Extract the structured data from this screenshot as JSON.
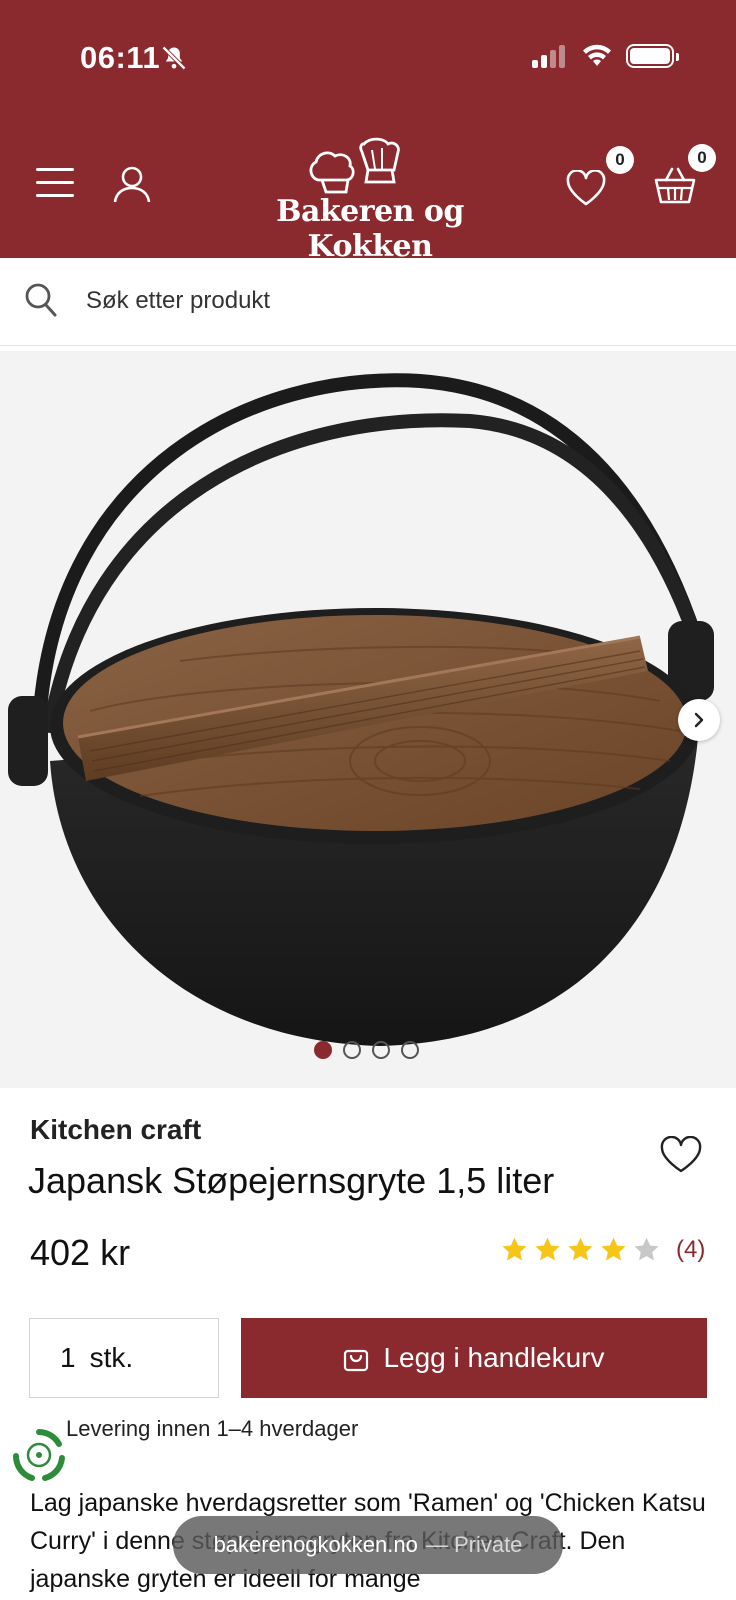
{
  "status_bar": {
    "time": "06:11",
    "icons": [
      "silent-mode-icon",
      "cellular-signal-icon",
      "wifi-icon",
      "battery-icon"
    ]
  },
  "header": {
    "logo_text": "Bakeren og Kokken",
    "wishlist_count": "0",
    "cart_count": "0",
    "icons": [
      "hamburger-menu-icon",
      "user-icon",
      "chef-hats-logo",
      "heart-icon",
      "basket-icon"
    ]
  },
  "search": {
    "placeholder": "Søk etter produkt"
  },
  "gallery": {
    "image_count": 4,
    "active_index": 0
  },
  "product": {
    "brand": "Kitchen craft",
    "title": "Japansk Støpejernsgryte 1,5 liter",
    "price": "402 kr",
    "rating": 4,
    "rating_max": 5,
    "rating_count": "(4)",
    "quantity": "1",
    "quantity_unit": "stk.",
    "add_to_cart_label": "Legg i handlekurv",
    "delivery": "Levering innen 1–4 hverdager",
    "description": "Lag japanske hverdagsretter som 'Ramen' og 'Chicken Katsu Curry' i denne støpejernsgryten fra Kitchen Craft. Den japanske gryten er ideell for mange"
  },
  "browser": {
    "url": "bakerenogkokken.no",
    "mode": "— Private"
  },
  "colors": {
    "brand": "#8b2a2e",
    "star": "#f5c518",
    "star_empty": "#c8c8c8"
  }
}
